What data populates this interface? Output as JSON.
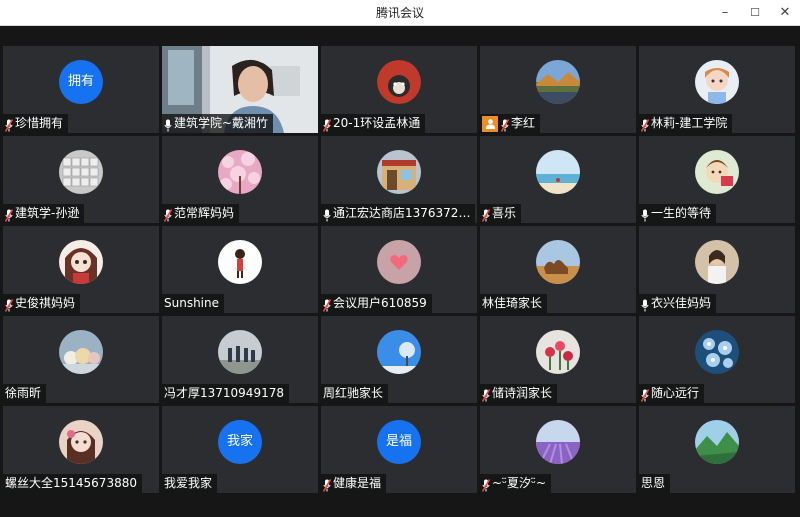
{
  "window": {
    "title": "腾讯会议",
    "minimize": "–",
    "maximize": "☐",
    "close": "✕"
  },
  "colors": {
    "tile_bg": "#2b2d30",
    "text_avatar_bg": "#1672f0",
    "host_badge": "#f08c24",
    "mic_red": "#e8463c"
  },
  "participants": [
    {
      "name": "珍惜拥有",
      "avatar_text": "拥有",
      "mic": "muted"
    },
    {
      "name": "建筑学院~戴湘竹",
      "video": true,
      "mic": "active"
    },
    {
      "name": "20-1环设孟林通",
      "mic": "muted",
      "avatar_icon": "dog-photo-icon"
    },
    {
      "name": "李红",
      "mic": "muted",
      "host": true,
      "avatar_icon": "landscape-photo-icon"
    },
    {
      "name": "林莉-建工学院",
      "mic": "muted",
      "avatar_icon": "cartoon-girl-icon"
    },
    {
      "name": "建筑学-孙逊",
      "mic": "muted",
      "avatar_icon": "keyboard-photo-icon"
    },
    {
      "name": "范常辉妈妈",
      "mic": "muted",
      "avatar_icon": "cherry-blossom-icon"
    },
    {
      "name": "通江宏达商店1376372…",
      "mic": "active",
      "avatar_icon": "storefront-icon"
    },
    {
      "name": "喜乐",
      "mic": "muted",
      "avatar_icon": "seaside-photo-icon"
    },
    {
      "name": "一生的等待",
      "mic": "active",
      "avatar_icon": "cartoon-doll-icon"
    },
    {
      "name": "史俊祺妈妈",
      "mic": "muted",
      "avatar_icon": "anime-girl-icon"
    },
    {
      "name": "Sunshine",
      "mic": "none",
      "avatar_icon": "girl-figure-icon"
    },
    {
      "name": "会议用户610859",
      "mic": "muted",
      "avatar_icon": "heart-icon"
    },
    {
      "name": "林佳琦家长",
      "mic": "none",
      "avatar_icon": "camel-desert-icon"
    },
    {
      "name": "衣兴佳妈妈",
      "mic": "active",
      "avatar_icon": "woman-photo-icon"
    },
    {
      "name": "徐雨昕",
      "mic": "none",
      "avatar_icon": "plush-toys-icon"
    },
    {
      "name": "冯才厚13710949178",
      "mic": "none",
      "avatar_icon": "people-outdoor-icon"
    },
    {
      "name": "周红驰家长",
      "mic": "none",
      "avatar_icon": "blue-sky-tree-icon"
    },
    {
      "name": "储诗润家长",
      "mic": "muted",
      "avatar_icon": "flowers-icon"
    },
    {
      "name": "随心远行",
      "mic": "muted",
      "avatar_icon": "blue-flowers-icon"
    },
    {
      "name": "螺丝大全15145673880",
      "mic": "none",
      "avatar_icon": "girl-portrait-icon"
    },
    {
      "name": "我爱我家",
      "avatar_text": "我家",
      "mic": "none"
    },
    {
      "name": "健康是福",
      "avatar_text": "是福",
      "mic": "muted"
    },
    {
      "name": "~ᵕ̈夏汐ᵕ̈~",
      "mic": "muted",
      "avatar_icon": "lavender-field-icon"
    },
    {
      "name": "思恩",
      "mic": "none",
      "avatar_icon": "green-mountain-icon"
    }
  ]
}
